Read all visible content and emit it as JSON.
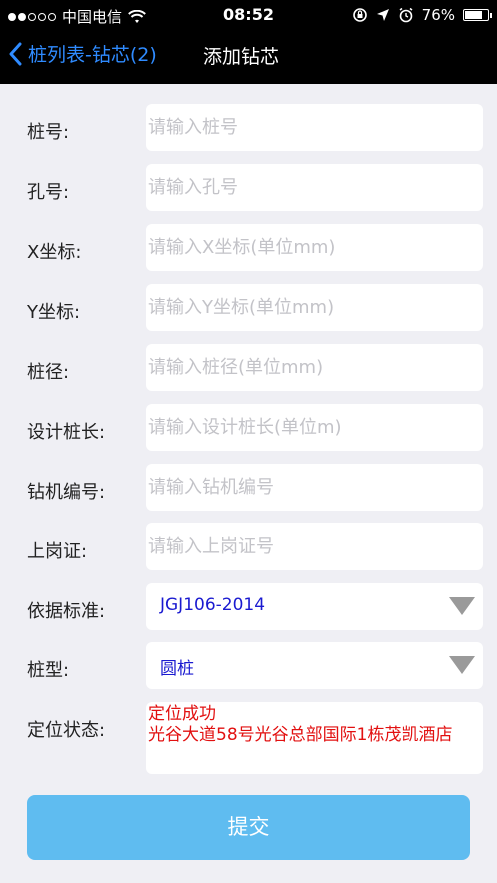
{
  "status_bar": {
    "carrier": "中国电信",
    "time": "08:52",
    "battery": "76%",
    "battery_level": 0.76
  },
  "nav": {
    "back_label": "桩列表-钻芯(2)",
    "title": "添加钻芯"
  },
  "form": {
    "fields": [
      {
        "label": "桩号:",
        "placeholder": "请输入桩号",
        "value": ""
      },
      {
        "label": "孔号:",
        "placeholder": "请输入孔号",
        "value": ""
      },
      {
        "label": "X坐标:",
        "placeholder": "请输入X坐标(单位mm)",
        "value": ""
      },
      {
        "label": "Y坐标:",
        "placeholder": "请输入Y坐标(单位mm)",
        "value": ""
      },
      {
        "label": "桩径:",
        "placeholder": "请输入桩径(单位mm)",
        "value": ""
      },
      {
        "label": "设计桩长:",
        "placeholder": "请输入设计桩长(单位m)",
        "value": ""
      },
      {
        "label": "钻机编号:",
        "placeholder": "请输入钻机编号",
        "value": ""
      },
      {
        "label": "上岗证:",
        "placeholder": "请输入上岗证号",
        "value": ""
      }
    ],
    "standard": {
      "label": "依据标准:",
      "value": "JGJ106-2014"
    },
    "pile_type": {
      "label": "桩型:",
      "value": "圆桩"
    },
    "location": {
      "label": "定位状态:",
      "status": "定位成功",
      "address": "光谷大道58号光谷总部国际1栋茂凯酒店"
    }
  },
  "submit_label": "提交",
  "colors": {
    "accent": "#2f8bff",
    "submit": "#5fbcf0",
    "location_text": "#e21010",
    "select_text": "#1a1ad0"
  }
}
